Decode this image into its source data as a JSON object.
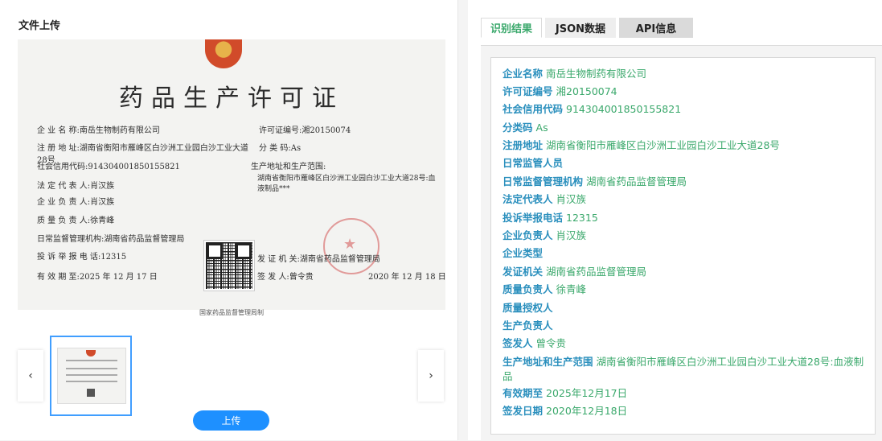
{
  "left_panel": {
    "title": "文件上传",
    "document": {
      "title": "药品生产许可证",
      "fields": [
        {
          "label": "企 业 名 称:",
          "value": "南岳生物制药有限公司"
        },
        {
          "label": "注 册 地 址:",
          "value": "湖南省衡阳市雁峰区白沙洲工业园白沙工业大道28号"
        },
        {
          "label": "社会信用代码:",
          "value": "914304001850155821"
        },
        {
          "label": "法 定 代 表 人:",
          "value": "肖汉族"
        },
        {
          "label": "企 业 负 责 人:",
          "value": "肖汉族"
        },
        {
          "label": "质 量 负 责 人:",
          "value": "徐青峰"
        },
        {
          "label": "日常监督管理机构:",
          "value": "湖南省药品监督管理局"
        },
        {
          "label": "投 诉 举 报 电 话:",
          "value": "12315"
        },
        {
          "label": "有 效 期 至:",
          "value": "2025 年 12 月 17 日"
        }
      ],
      "right_fields": {
        "license_label": "许可证编号:",
        "license_value": "湘20150074",
        "category_label": "分 类 码:",
        "category_value": "As",
        "scope_label": "生产地址和生产范围:",
        "scope_value": "湖南省衡阳市雁峰区白沙洲工业园白沙工业大道28号:血液制品***",
        "issuer_label": "发 证 机 关:",
        "issuer_value": "湖南省药品监督管理局",
        "signer_label": "签 发 人:",
        "signer_value": "曾令贵",
        "issue_date": "2020 年 12 月 18 日"
      },
      "footer": "国家药品监督管理局制"
    },
    "carousel": {
      "prev_icon": "‹",
      "next_icon": "›"
    },
    "upload_label": "上传"
  },
  "right_panel": {
    "tabs": [
      {
        "label": "识别结果"
      },
      {
        "label": "JSON数据"
      },
      {
        "label": "API信息"
      }
    ],
    "results": [
      {
        "key": "企业名称",
        "value": "南岳生物制药有限公司"
      },
      {
        "key": "许可证编号",
        "value": "湘20150074"
      },
      {
        "key": "社会信用代码",
        "value": "914304001850155821"
      },
      {
        "key": "分类码",
        "value": "As"
      },
      {
        "key": "注册地址",
        "value": "湖南省衡阳市雁峰区白沙洲工业园白沙工业大道28号"
      },
      {
        "key": "日常监管人员",
        "value": ""
      },
      {
        "key": "日常监督管理机构",
        "value": "湖南省药品监督管理局"
      },
      {
        "key": "法定代表人",
        "value": "肖汉族"
      },
      {
        "key": "投诉举报电话",
        "value": "12315"
      },
      {
        "key": "企业负责人",
        "value": "肖汉族"
      },
      {
        "key": "企业类型",
        "value": ""
      },
      {
        "key": "发证机关",
        "value": "湖南省药品监督管理局"
      },
      {
        "key": "质量负责人",
        "value": "徐青峰"
      },
      {
        "key": "质量授权人",
        "value": ""
      },
      {
        "key": "生产负责人",
        "value": ""
      },
      {
        "key": "签发人",
        "value": "曾令贵"
      },
      {
        "key": "生产地址和生产范围",
        "value": "湖南省衡阳市雁峰区白沙洲工业园白沙工业大道28号:血液制品"
      },
      {
        "key": "有效期至",
        "value": "2025年12月17日"
      },
      {
        "key": "签发日期",
        "value": "2020年12月18日"
      }
    ]
  }
}
